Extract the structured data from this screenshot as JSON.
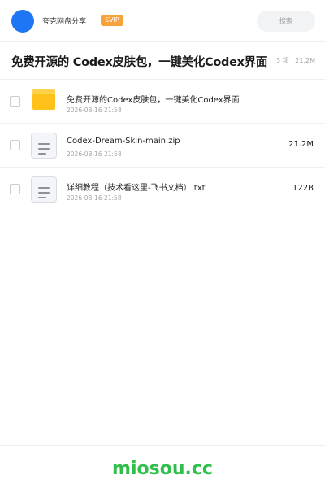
{
  "header": {
    "user_name": "夸克网盘分享",
    "badge": "SVIP",
    "search_placeholder": "搜索"
  },
  "share": {
    "title": "免费开源的 Codex皮肤包，一键美化Codex界面",
    "meta": "3 项 · 21.2M"
  },
  "files": [
    {
      "type": "folder",
      "name": "免费开源的Codex皮肤包，一键美化Codex界面",
      "date": "2026-08-16 21:58",
      "size": ""
    },
    {
      "type": "file",
      "name": "Codex-Dream-Skin-main.zip",
      "date": "2026-08-16 21:58",
      "size": "21.2M"
    },
    {
      "type": "file",
      "name": "详细教程（技术看这里-飞书文档）.txt",
      "date": "2026-08-16 21:58",
      "size": "122B"
    }
  ],
  "footer": {
    "watermark": "miosou.cc"
  },
  "colors": {
    "accent_blue": "#1f76f5",
    "svip": "#f7a23b",
    "folder": "#ffc11a",
    "watermark": "#2fbf4a"
  }
}
